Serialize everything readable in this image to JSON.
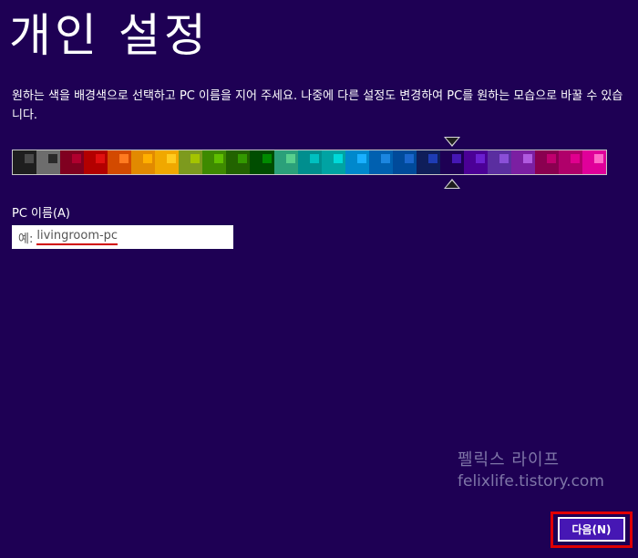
{
  "page": {
    "title": "개인 설정",
    "description": "원하는 색을 배경색으로 선택하고 PC 이름을 지어 주세요. 나중에 다른 설정도 변경하여 PC를 원하는 모습으로 바꿀 수 있습니다."
  },
  "palette": {
    "selected_index": 19,
    "swatches": [
      {
        "bg": "#1e1e1e",
        "dot": "#4a4a4a"
      },
      {
        "bg": "#6d6d6d",
        "dot": "#2a2a2a"
      },
      {
        "bg": "#800020",
        "dot": "#b0002e"
      },
      {
        "bg": "#b30000",
        "dot": "#e01010"
      },
      {
        "bg": "#d34a00",
        "dot": "#ff7a20"
      },
      {
        "bg": "#e28a00",
        "dot": "#ffb000"
      },
      {
        "bg": "#f0a800",
        "dot": "#ffcc20"
      },
      {
        "bg": "#7d9a1e",
        "dot": "#a4c400"
      },
      {
        "bg": "#3e8a00",
        "dot": "#5fbf00"
      },
      {
        "bg": "#226300",
        "dot": "#339900"
      },
      {
        "bg": "#004d00",
        "dot": "#008a00"
      },
      {
        "bg": "#2ba07a",
        "dot": "#58d08e"
      },
      {
        "bg": "#008e8e",
        "dot": "#00c0c0"
      },
      {
        "bg": "#00a3a3",
        "dot": "#00d9d9"
      },
      {
        "bg": "#0088cc",
        "dot": "#1ab0ff"
      },
      {
        "bg": "#0060b0",
        "dot": "#1c86e0"
      },
      {
        "bg": "#004a9a",
        "dot": "#1a66cc"
      },
      {
        "bg": "#0f1e5a",
        "dot": "#1e3cb4"
      },
      {
        "bg": "#1e0054",
        "dot": "#4617b4"
      },
      {
        "bg": "#4b0096",
        "dot": "#6a1fd0"
      },
      {
        "bg": "#5a2ea0",
        "dot": "#8a4fd8"
      },
      {
        "bg": "#7b1fa2",
        "dot": "#b05ae0"
      },
      {
        "bg": "#8a0050",
        "dot": "#c0006e"
      },
      {
        "bg": "#b0006a",
        "dot": "#e0008e"
      },
      {
        "bg": "#e0009a",
        "dot": "#ff69c8"
      }
    ]
  },
  "pc_name": {
    "label": "PC 이름(A)",
    "prefix": "예:",
    "value": "livingroom-pc"
  },
  "watermark": {
    "korean": "펠릭스 라이프",
    "url": "felixlife.tistory.com"
  },
  "buttons": {
    "next_label": "다음(N)"
  }
}
